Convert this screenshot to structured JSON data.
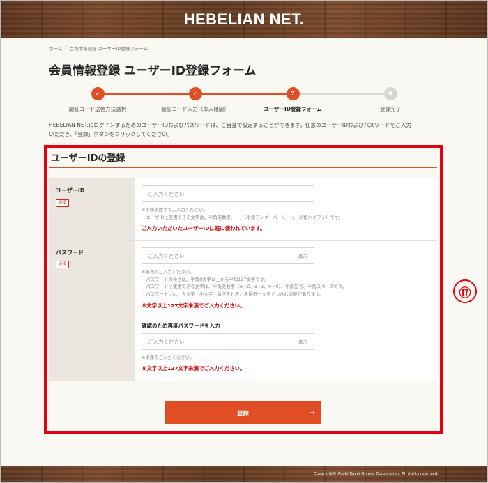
{
  "header": {
    "logo": "HEBELIAN NET."
  },
  "breadcrumb": [
    "ホーム",
    "/",
    "会員情報登録 ユーザーID登録フォーム"
  ],
  "page_title": "会員情報登録 ユーザーID登録フォーム",
  "steps": [
    {
      "num": "✓",
      "label": "認証コード送信方法選択",
      "state": "done"
    },
    {
      "num": "✓",
      "label": "認証コード入力（本人確認）",
      "state": "done"
    },
    {
      "num": "7",
      "label": "ユーザーID登録フォーム",
      "state": "current"
    },
    {
      "num": "8",
      "label": "登録完了",
      "state": "pending"
    }
  ],
  "intro_line1": "HEBELIAN NET.にログインするためのユーザーIDおよびパスワードは、ご自身で設定することができます。任意のユーザーIDおよびパスワードをご入力",
  "intro_line2": "いただき、「登録」ボタンをクリックしてください。",
  "section_title": "ユーザーIDの登録",
  "required_label": "必須",
  "userid": {
    "label": "ユーザーID",
    "placeholder": "ご入力ください",
    "hint1": "※半角英数字でご入力ください。",
    "hint2": "・ユーザIDに使用できる文字は、半角英数字、「_」（半角アンダーバー）、「-」（半角ハイフン）です。",
    "error": "ご入力いただいたユーザーIDは既に使われています。"
  },
  "password": {
    "label": "パスワード",
    "placeholder": "ご入力ください",
    "toggle": "表示",
    "hint1": "※半角でご入力ください。",
    "hint2": "・パスワードの長さは、半角8文字以上から半角127文字です。",
    "hint3": "・パスワードに使用できる文字は、半角英数字（A～Z、a～z、0～9）、半角記号、半角スペースです。",
    "hint4": "・パスワードには、大文字・小文字・数字それぞれを最低一文字ずつ含む必要があります。",
    "error": "８文字以上127文字未満でご入力ください。",
    "confirm_label": "確認のため再度パスワードを入力",
    "confirm_placeholder": "ご入力ください",
    "confirm_toggle": "表示",
    "confirm_hint": "※半角でご入力ください。",
    "confirm_error": "８文字以上127文字未満でご入力ください。"
  },
  "submit": {
    "label": "登録",
    "arrow": "→"
  },
  "annotation": "⑰",
  "footer": {
    "copyright": "Copyright© Asahi Kasei Homes Corporation. All rights reserved."
  },
  "colors": {
    "accent": "#e14d24",
    "error": "#d40000",
    "highlight": "#e60012",
    "pending": "#d9d6d0"
  }
}
